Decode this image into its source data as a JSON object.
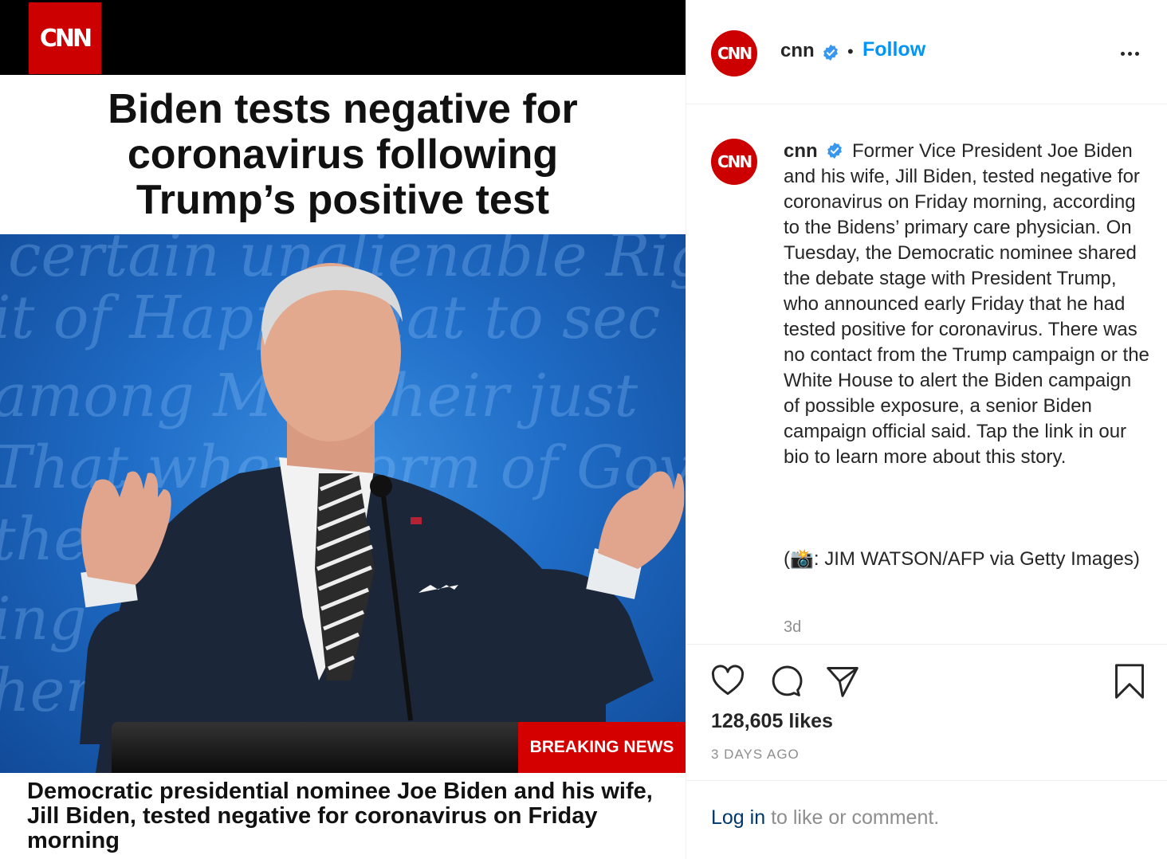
{
  "post_image": {
    "logo_text": "CNN",
    "headline": "Biden tests negative for\ncoronavirus following\nTrump’s positive test",
    "breaking_label": "BREAKING NEWS",
    "caption": "Democratic presidential nominee Joe Biden and his wife, Jill Biden, tested negative for coronavirus on Friday morning"
  },
  "header": {
    "avatar_text": "CNN",
    "username": "cnn",
    "separator": "•",
    "follow_label": "Follow",
    "more_icon": "more-options-icon"
  },
  "caption": {
    "avatar_text": "CNN",
    "username": "cnn",
    "text": "Former Vice President Joe Biden and his wife, Jill Biden, tested negative for coronavirus on Friday morning, according to the Bidens’ primary care physician. On Tuesday, the Democratic nominee shared the debate stage with President Trump, who announced early Friday that he had tested positive for coronavirus. There was no contact from the Trump campaign or the White House to alert the Biden campaign of possible exposure, a senior Biden campaign official said. Tap the link in our bio to learn more about this story.",
    "credit": "(📸: JIM WATSON/AFP via Getty Images)",
    "time": "3d"
  },
  "actions": {
    "icons": [
      "heart-icon",
      "comment-icon",
      "share-icon",
      "bookmark-icon"
    ],
    "likes": "128,605 likes",
    "date": "3 DAYS AGO"
  },
  "login": {
    "link_text": "Log in",
    "rest_text": " to like or comment."
  },
  "colors": {
    "brand_red": "#cc0000",
    "follow_blue": "#0095f6",
    "verified_blue": "#3897f0",
    "muted": "#8e8e8e",
    "login_link": "#00376b"
  }
}
